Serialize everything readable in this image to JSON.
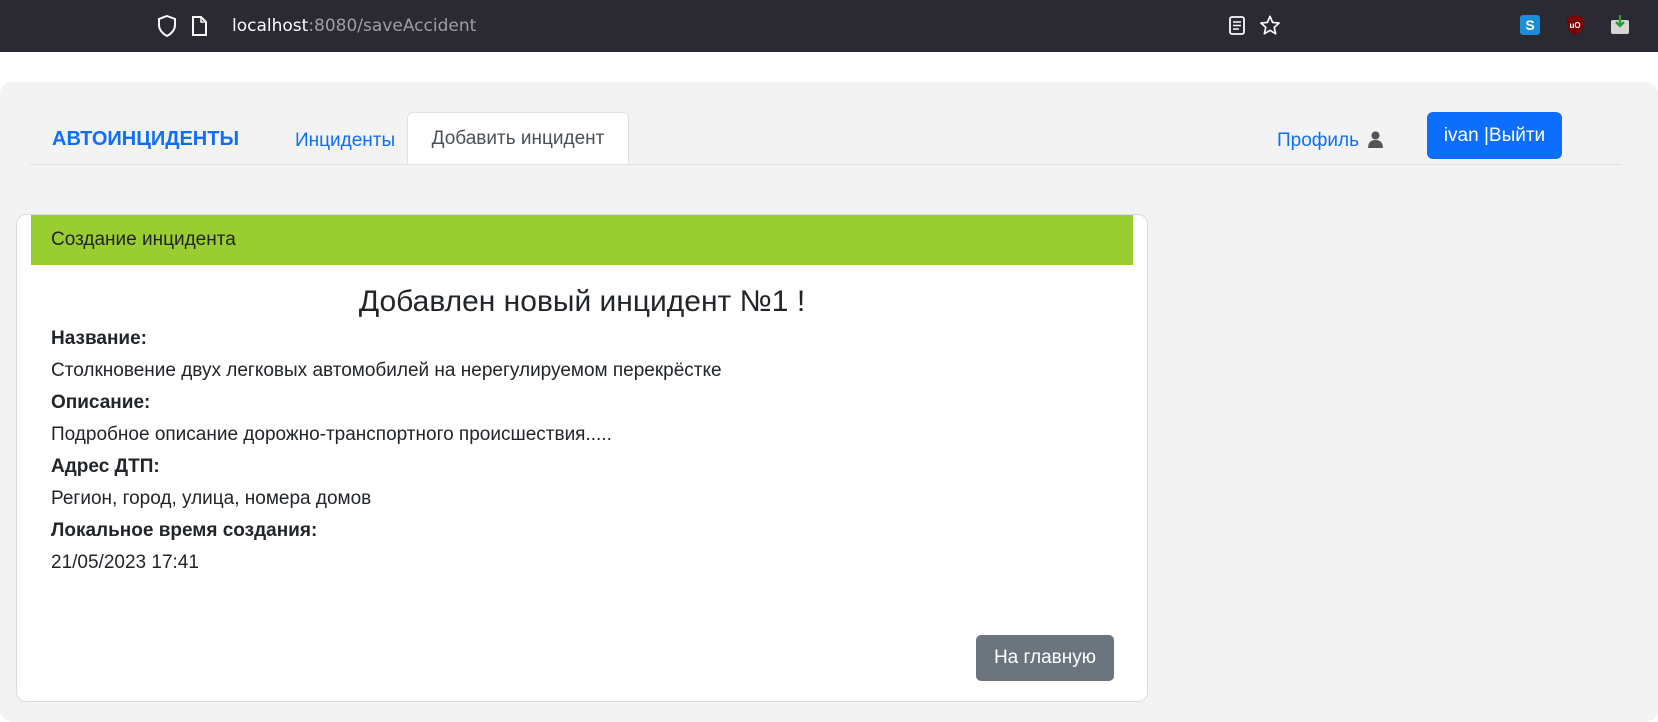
{
  "browser": {
    "url_host": "localhost",
    "url_path": ":8080/saveAccident",
    "extension_s_letter": "S",
    "extension_ub_letters": "uO"
  },
  "nav": {
    "brand": "АВТОИНЦИДЕНТЫ",
    "incidents_link": "Инциденты",
    "add_incident_tab": "Добавить инцидент",
    "profile_link": "Профиль",
    "logout_button": "ivan |Выйти"
  },
  "card": {
    "header": "Создание инцидента",
    "success_title": "Добавлен новый инцидент №1 !",
    "fields": [
      {
        "label": "Название:",
        "value": "Столкновение двух легковых автомобилей на нерегулируемом перекрёстке"
      },
      {
        "label": "Описание:",
        "value": "Подробное описание дорожно-транспортного происшествия....."
      },
      {
        "label": "Адрес ДТП:",
        "value": "Регион, город, улица, номера домов"
      },
      {
        "label": "Локальное время создания:",
        "value": "21/05/2023 17:41"
      }
    ],
    "home_button": "На главную"
  },
  "colors": {
    "accent": "#0d6efd",
    "card_header": "#9acd32",
    "secondary_button": "#6c757d",
    "browser_bar": "#2b2a33"
  },
  "icons": {
    "shield": "shield-icon",
    "page": "page-icon",
    "reader": "reader-view-icon",
    "bookmark": "star-icon",
    "profile": "user-icon"
  }
}
